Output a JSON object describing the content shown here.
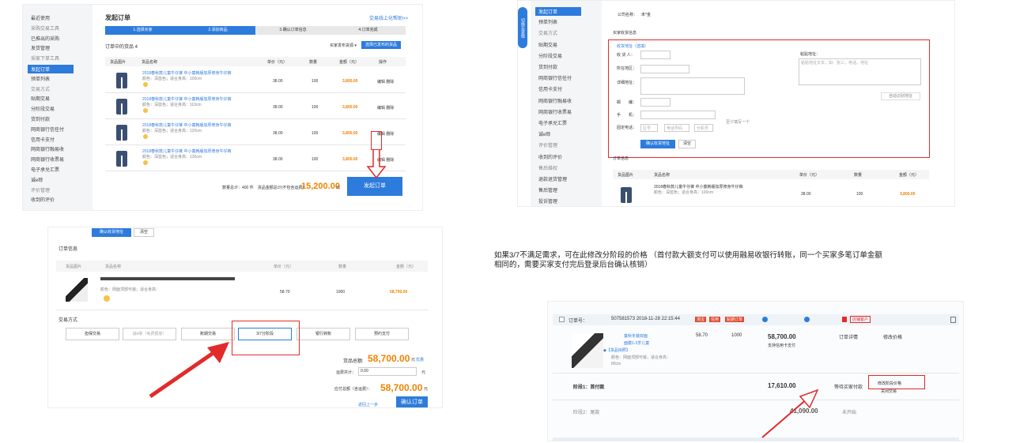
{
  "p1": {
    "sidebar": [
      "最近使用",
      "采购交易工具",
      "已推出的采购",
      "发货管理",
      "采家下单工具",
      "发起订单",
      "预单列表",
      "交易方式",
      "贴期交易",
      "分阶段交易",
      "货到付款",
      "网商银行信任付",
      "信用卡支付",
      "网商银行融易收",
      "网商银行收票易",
      "电子承兑汇票",
      "诚e赊",
      "评价管理",
      "收到的评价"
    ],
    "title": "发起订单",
    "help": "交易线上化帮助>>",
    "steps": [
      "1.选择买家",
      "2.添加商品",
      "3.确认订单信息",
      "4.订单完成"
    ],
    "list_title": "订单中的货品 4",
    "filter": "买家发布货源 ▾",
    "add_btn": "选择已发布的货品",
    "cols": [
      "货品图片",
      "货品名称",
      "单价（元）",
      "数量",
      "金额（元）",
      "操作"
    ],
    "rows": [
      {
        "name": "2018春秋款儿童牛仔裤 中小童韩版加厚修身牛仔裤",
        "spec": "颜色：深蓝色；适合身高：100cm",
        "price": "38.00",
        "qty": "100",
        "amount": "3,800.00",
        "ops": "编辑 删除"
      },
      {
        "name": "2018春秋款儿童牛仔裤 中小童韩版加厚修身牛仔裤",
        "spec": "颜色：深蓝色；适合身高：110cm",
        "price": "38.00",
        "qty": "100",
        "amount": "3,800.00",
        "ops": "编辑 删除"
      },
      {
        "name": "2018春秋款儿童牛仔裤 中小童韩版加厚修身牛仔裤",
        "spec": "颜色：深蓝色；适合身高：120cm",
        "price": "38.00",
        "qty": "100",
        "amount": "3,800.00",
        "ops": "编辑 删除"
      },
      {
        "name": "2018春秋款儿童牛仔裤 中小童韩版加厚修身牛仔裤",
        "spec": "颜色：深蓝色；适合身高：130cm",
        "price": "38.00",
        "qty": "100",
        "amount": "3,800.00",
        "ops": "编辑 删除"
      }
    ],
    "total_label": "数量总计：400 件　货品金额总计(不包含运费)：",
    "total": "15,200.00",
    "currency": "元",
    "submit": "发起订单"
  },
  "p2": {
    "side_tab": "切换买家版",
    "sidebar": [
      "发起订单",
      "预单列表",
      "交易方式",
      "贴期交易",
      "分阶段交易",
      "货到付款",
      "网商银行信任付",
      "信用卡支付",
      "网商银行融易收",
      "网商银行收票易",
      "电子承兑汇票",
      "诚e赊",
      "评价管理",
      "收到的评价",
      "售后维权",
      "退款退货管理",
      "售后管理",
      "投诉管理"
    ],
    "company_label": "公司名称：",
    "company_value": "未*金",
    "section": "买家收货信息",
    "addr_title": "收货地址（选填）",
    "labels": [
      "收 货 人：",
      "所在地区：",
      "详细地址：",
      "邮　　编：",
      "手　　机：",
      "固定电话："
    ],
    "phone_hint": "至少填写一个",
    "tel_ph": [
      "区号",
      "电话号码",
      "分机号"
    ],
    "confirm": "确认收货地址",
    "clear": "清空",
    "quick_label": "粘贴地址：",
    "quick_ph": "粘贴地址文本，如：张三，电话，地址",
    "parse_btn": "自动识别地址",
    "order_section": "订单信息",
    "cols": [
      "货品图片",
      "货品名称",
      "单价（元）",
      "数量",
      "金额（元）"
    ],
    "row": {
      "name": "2018春秋款儿童牛仔裤 中小童韩版加厚修身牛仔裤",
      "spec": "颜色：深蓝色；适合身高：100cm",
      "price": "38.00",
      "qty": "100",
      "amount": "3,800.00"
    }
  },
  "p3": {
    "confirm": "确认收货地址",
    "clear": "清空",
    "order_section": "订单信息",
    "cols": [
      "货品图片",
      "货品名称",
      "单价（元）",
      "数量",
      "金额（元）"
    ],
    "row": {
      "spec": "颜色：网面顶部可装；适合身高：",
      "price": "58.70",
      "qty": "1000",
      "amount": "58,700.00"
    },
    "trade_section": "交易方式",
    "methods": [
      "担保交易",
      "诚e赊（免费额度）",
      "账期交易",
      "3/7分阶段",
      "银行转账",
      "预约支付"
    ],
    "goods_total_label": "货品总额:",
    "goods_total": "58,700.00",
    "unit": "元",
    "save_link": "优惠",
    "freight_label": "运费共计：",
    "freight": "0.00",
    "pay_label": "应付总额（含运费）：",
    "pay": "58,700.00",
    "back": "返回上一步",
    "submit": "确认订单"
  },
  "p4": {
    "order_label": "订单号：",
    "order_no": "507581573 2018-11-28 22:15:44",
    "tags": [
      "淘宝",
      "信用",
      "贴期订单"
    ],
    "shop_tag": "店铺客户",
    "item_lines": [
      "童秋冬装双面",
      "面膜1-3岁儿童"
    ],
    "item_tag": "◆【货品快照】",
    "item_spec": "颜色：网面顶部可装，适合身高：",
    "item_size": "80cm",
    "price": "58.70",
    "qty": "1000",
    "amount": "58,700.00",
    "pay_sub": "支持信用卡支付",
    "detail": "订单详情",
    "modify": "修改价格",
    "stage1": "阶段1：首付款",
    "stage1_amt": "17,610.00",
    "stage1_status": "等待买家付款",
    "stage1_act1": "修改阶段价格",
    "stage1_act2": "关闭交易",
    "stage2": "阶段2：尾款",
    "stage2_amt": "41,090.00",
    "stage2_status": "未开始"
  },
  "note": {
    "l1": "如果3/7不满足需求，可在此修改分阶段的价格 （首付款大额支付可以使用融易收银行转账，同一个买家多笔订单金额",
    "l2": "相同的，需要买家支付完后登录后台确认核销）"
  },
  "colors": {
    "accent": "#2d7bdc",
    "red": "#e32a2a",
    "orange": "#f08200"
  }
}
